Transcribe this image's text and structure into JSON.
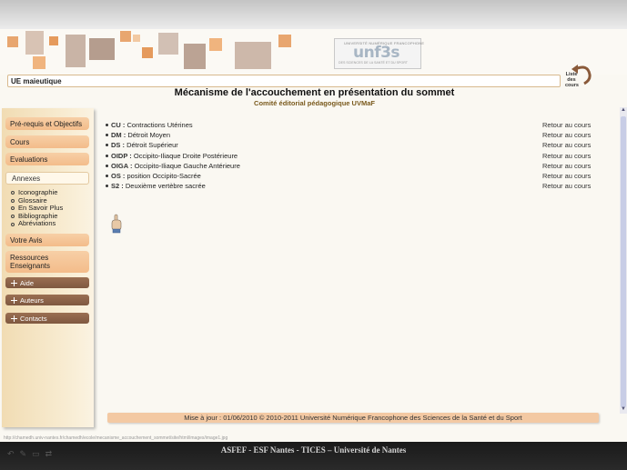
{
  "banner": {
    "logo_small": "UNIVERSITÉ NUMÉRIQUE FRANCOPHONE",
    "logo_big": "unf3s",
    "logo_sub": "DES SCIENCES DE LA SANTÉ ET DU SPORT",
    "list_courses_label": "Liste des cours"
  },
  "course": {
    "title": "UE maieutique"
  },
  "page": {
    "title": "Mécanisme de l'accouchement en présentation du sommet",
    "subtitle": "Comité éditorial pédagogique UVMaF"
  },
  "sidebar": {
    "prereq": "Pré-requis et Objectifs",
    "cours": "Cours",
    "evaluations": "Evaluations",
    "annexes": "Annexes",
    "annex_items": [
      "Iconographie",
      "Glossaire",
      "En Savoir Plus",
      "Bibliographie",
      "Abréviations"
    ],
    "votre_avis": "Votre Avis",
    "ressources": "Ressources Enseignants",
    "aide": "Aide",
    "auteurs": "Auteurs",
    "contacts": "Contacts"
  },
  "abbreviations": [
    {
      "abbr": "CU :",
      "text": "Contractions Utérines",
      "back": "Retour au cours"
    },
    {
      "abbr": "DM :",
      "text": "Détroit Moyen",
      "back": "Retour au cours"
    },
    {
      "abbr": "DS :",
      "text": "Détroit Supérieur",
      "back": "Retour au cours"
    },
    {
      "abbr": "OIDP :",
      "text": "Occipito-Iliaque Droite Postérieure",
      "back": "Retour au cours"
    },
    {
      "abbr": "OIGA :",
      "text": "Occipito-Iliaque Gauche Antérieure",
      "back": "Retour au cours"
    },
    {
      "abbr": "OS :",
      "text": "position Occipito-Sacrée",
      "back": "Retour au cours"
    },
    {
      "abbr": "S2 :",
      "text": "Deuxième vertèbre sacrée",
      "back": "Retour au cours"
    }
  ],
  "footer": {
    "text": "Mise à jour : 01/06/2010 © 2010-2011 Université Numérique Francophone des Sciences de la Santé et du Sport"
  },
  "status_url": "http://chamedh.univ-nantes.fr/chamedh/ecole/mecanisme_accouchement_sommet/site/html/images/image1.jpg",
  "bottom_bar": {
    "text": "ASFEF - ESF Nantes - TICES – Université de Nantes"
  },
  "colors": {
    "menu_light": "#f3bc8a",
    "menu_dark": "#8a6249",
    "sidebar_bg": "#f6e6c4",
    "footer_bg": "#f3c9a3",
    "accent_brown": "#7a5a1d"
  }
}
